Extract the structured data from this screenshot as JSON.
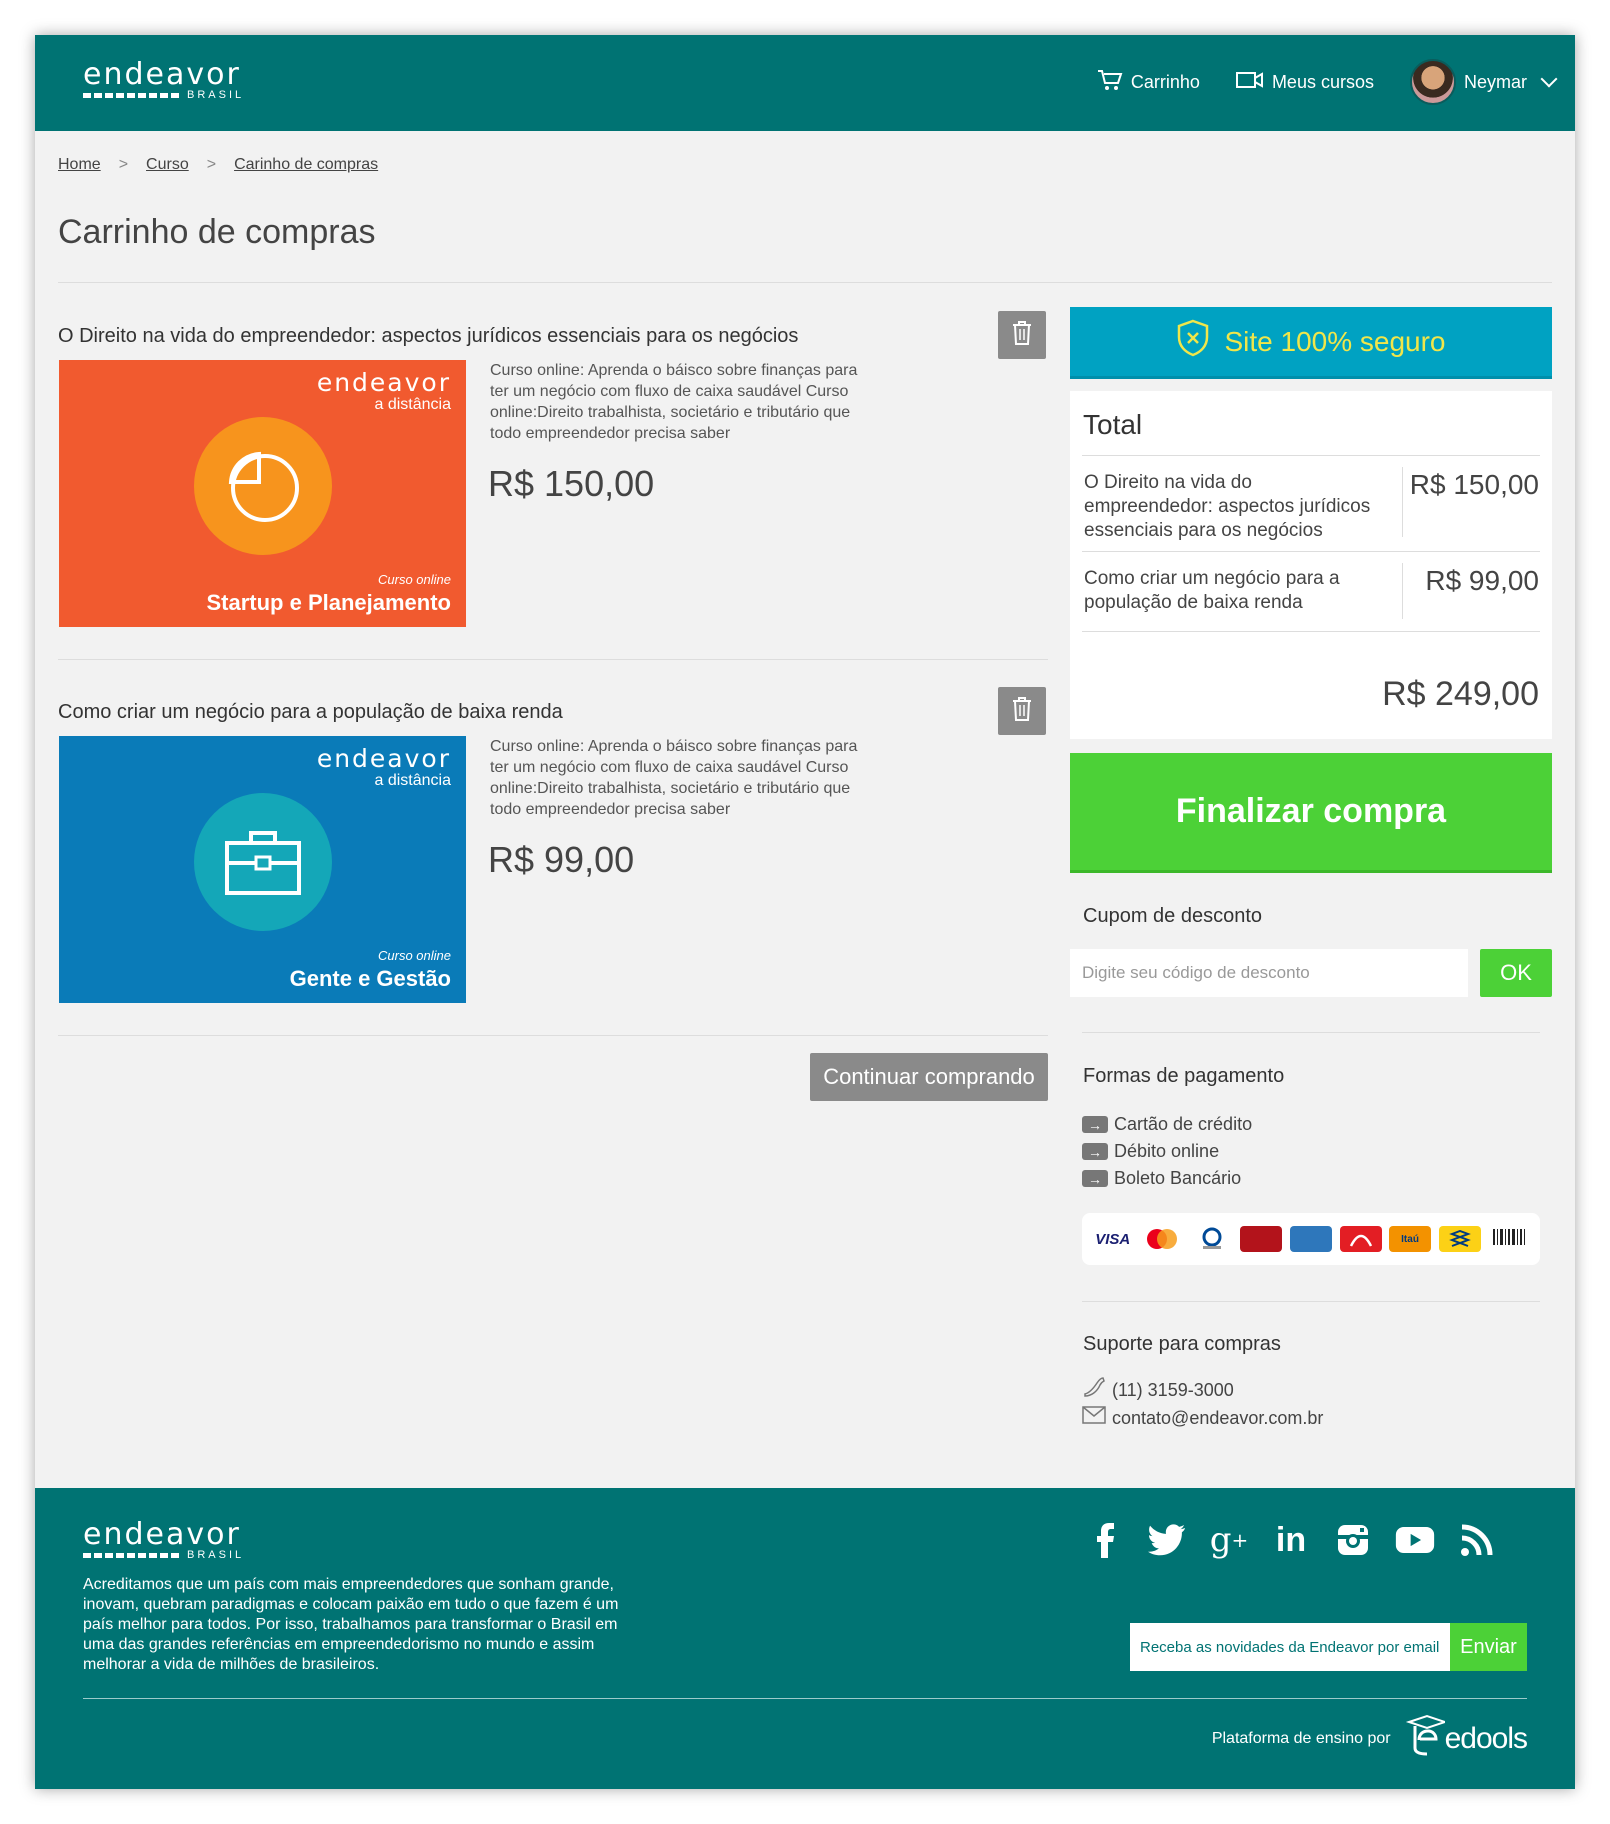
{
  "brand": {
    "name": "endeavor",
    "sub": "BRASIL"
  },
  "nav": {
    "cart": "Carrinho",
    "courses": "Meus cursos",
    "user": "Neymar"
  },
  "breadcrumb": [
    "Home",
    "Curso",
    "Carinho de compras"
  ],
  "page_title": "Carrinho de compras",
  "items": [
    {
      "title": "O Direito na vida do empreendedor: aspectos jurídicos essenciais para os negócios",
      "thumb_logo": "endeavor",
      "thumb_sub": "a distância",
      "thumb_tag": "Curso online",
      "thumb_name": "Startup e Planejamento",
      "thumb_color": "#f15a2f",
      "circle_color": "#f7941d",
      "icon": "pie-chart-icon",
      "desc": "Curso online: Aprenda o báisco sobre finanças para ter um negócio com fluxo de caixa saudável Curso online:Direito trabalhista, societário e tributário que todo empreendedor precisa saber",
      "price": "R$ 150,00"
    },
    {
      "title": "Como criar um negócio para a população de baixa renda",
      "thumb_logo": "endeavor",
      "thumb_sub": "a distância",
      "thumb_tag": "Curso online",
      "thumb_name": "Gente e Gestão",
      "thumb_color": "#0a7bb8",
      "circle_color": "#14a7b8",
      "icon": "briefcase-icon",
      "desc": "Curso online: Aprenda o báisco sobre finanças para ter um negócio com fluxo de caixa saudável Curso online:Direito trabalhista, societário e tributário que todo empreendedor precisa saber",
      "price": "R$ 99,00"
    }
  ],
  "continue_label": "Continuar comprando",
  "secure_label": "Site 100% seguro",
  "total": {
    "title": "Total",
    "rows": [
      {
        "name": "O Direito na vida do empreendedor: aspectos jurídicos essenciais para os negócios",
        "price": "R$ 150,00"
      },
      {
        "name": "Como criar um negócio para a população de baixa renda",
        "price": "R$ 99,00"
      }
    ],
    "sum": "R$ 249,00"
  },
  "finalize_label": "Finalizar compra",
  "coupon": {
    "title": "Cupom de desconto",
    "placeholder": "Digite seu código de desconto",
    "ok": "OK"
  },
  "payment": {
    "title": "Formas de pagamento",
    "methods": [
      "Cartão de crédito",
      "Débito online",
      "Boleto Bancário"
    ],
    "cards": [
      "VISA",
      "MasterCard",
      "Diners",
      "Hipercard",
      "American Express",
      "Aura",
      "Itaú",
      "Banco do Brasil",
      "Boleto"
    ]
  },
  "support": {
    "title": "Suporte para compras",
    "phone": "(11) 3159-3000",
    "email": "contato@endeavor.com.br"
  },
  "footer": {
    "text": "Acreditamos que um país com mais empreendedores que sonham grande, inovam, quebram paradigmas e colocam paixão em tudo o que fazem é um país melhor para todos. Por isso, trabalhamos para transformar o Brasil em uma das grandes referências em empreendedorismo no mundo e assim melhorar a vida de milhões de brasileiros.",
    "social": [
      "facebook-icon",
      "twitter-icon",
      "google-plus-icon",
      "linkedin-icon",
      "instagram-icon",
      "youtube-icon",
      "rss-icon"
    ],
    "newsletter_placeholder": "Receba as novidades da Endeavor por email",
    "send": "Enviar",
    "powered": "Plataforma de ensino por",
    "platform": "edools"
  },
  "colors": {
    "header": "#007373",
    "secure": "#00a2c2",
    "accent_green": "#4cd137",
    "button_gray": "#8a8a8a"
  }
}
